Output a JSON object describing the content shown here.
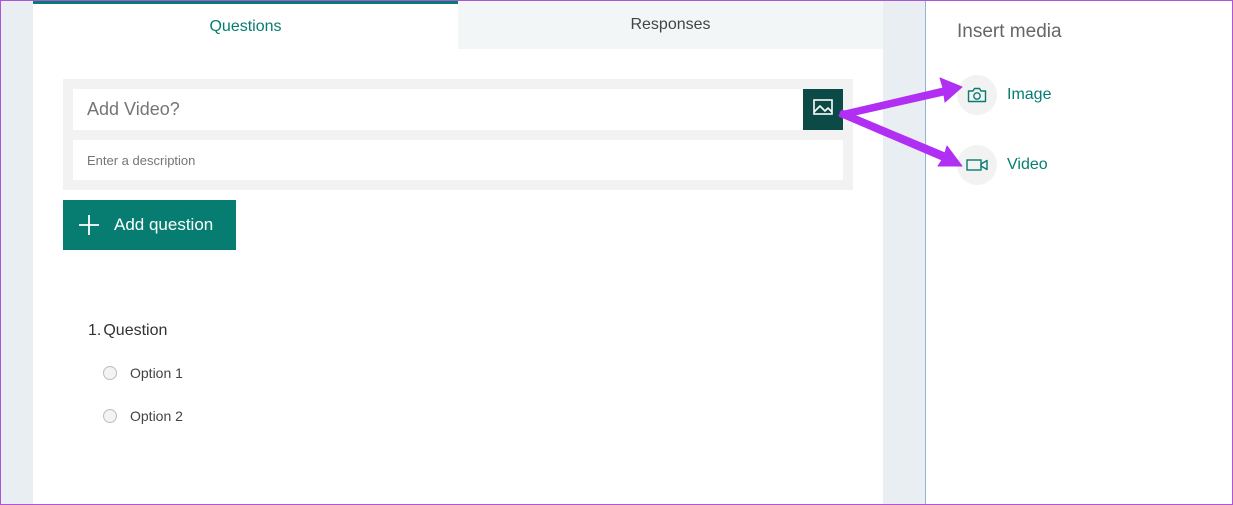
{
  "tabs": [
    {
      "label": "Questions",
      "active": true
    },
    {
      "label": "Responses",
      "active": false
    }
  ],
  "section": {
    "title_placeholder": "Add Video?",
    "description_placeholder": "Enter a description"
  },
  "add_question": {
    "label": "Add question"
  },
  "question": {
    "number": "1.",
    "title": "Question",
    "options": [
      "Option 1",
      "Option 2"
    ]
  },
  "insert_media": {
    "title": "Insert media",
    "items": [
      {
        "label": "Image",
        "icon": "camera-icon"
      },
      {
        "label": "Video",
        "icon": "video-camera-icon"
      }
    ]
  },
  "colors": {
    "accent": "#077d71",
    "media_button": "#0b4a46",
    "annotation_arrow": "#b12ff2",
    "frame_border": "#b153d8"
  }
}
